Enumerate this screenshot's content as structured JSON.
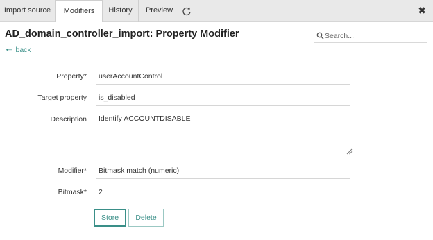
{
  "tabs": [
    {
      "label": "Import source",
      "active": false
    },
    {
      "label": "Modifiers",
      "active": true
    },
    {
      "label": "History",
      "active": false
    },
    {
      "label": "Preview",
      "active": false
    }
  ],
  "icons": {
    "refresh": "refresh-icon",
    "close": "close-icon",
    "search": "search-icon",
    "back": "arrow-left-icon"
  },
  "close_glyph": "✖",
  "page": {
    "title": "AD_domain_controller_import: Property Modifier",
    "back_label": "back"
  },
  "search": {
    "placeholder": "Search..."
  },
  "form": {
    "property": {
      "label": "Property*",
      "value": "userAccountControl"
    },
    "target_property": {
      "label": "Target property",
      "value": "is_disabled"
    },
    "description": {
      "label": "Description",
      "value": "Identify ACCOUNTDISABLE"
    },
    "modifier": {
      "label": "Modifier*",
      "value": "Bitmask match (numeric)"
    },
    "bitmask": {
      "label": "Bitmask*",
      "value": "2"
    }
  },
  "buttons": {
    "store": "Store",
    "delete": "Delete"
  },
  "colors": {
    "accent": "#3a8f88",
    "tabbar": "#e9e9e9"
  }
}
